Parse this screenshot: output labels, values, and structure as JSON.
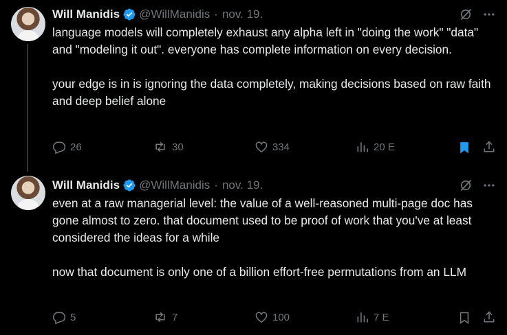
{
  "tweets": [
    {
      "author_name": "Will Manidis",
      "handle": "@WillManidis",
      "separator": "·",
      "date": "nov. 19.",
      "text": "language models will completely exhaust any alpha left in \"doing the work\" \"data\" and \"modeling it out\". everyone has complete information on every decision.\n\nyour edge is in is ignoring the data completely, making decisions based on raw faith and deep belief alone",
      "replies": "26",
      "reposts": "30",
      "likes": "334",
      "views": "20 E",
      "bookmarked": true
    },
    {
      "author_name": "Will Manidis",
      "handle": "@WillManidis",
      "separator": "·",
      "date": "nov. 19.",
      "text": "even at a raw managerial level: the value of a well-reasoned multi-page doc has gone almost to zero. that document used to be proof of work that you've at least considered the ideas for a while\n\nnow that document is only one of a billion effort-free permutations from an LLM",
      "replies": "5",
      "reposts": "7",
      "likes": "100",
      "views": "7 E",
      "bookmarked": false
    }
  ],
  "colors": {
    "background": "#000000",
    "text": "#e7e9ea",
    "muted": "#71767b",
    "verified": "#1d9bf0",
    "bookmark_active": "#1d9bf0"
  },
  "icons": [
    "verified-badge-icon",
    "grok-icon",
    "more-icon",
    "reply-icon",
    "repost-icon",
    "like-icon",
    "views-icon",
    "bookmark-icon",
    "share-icon"
  ]
}
